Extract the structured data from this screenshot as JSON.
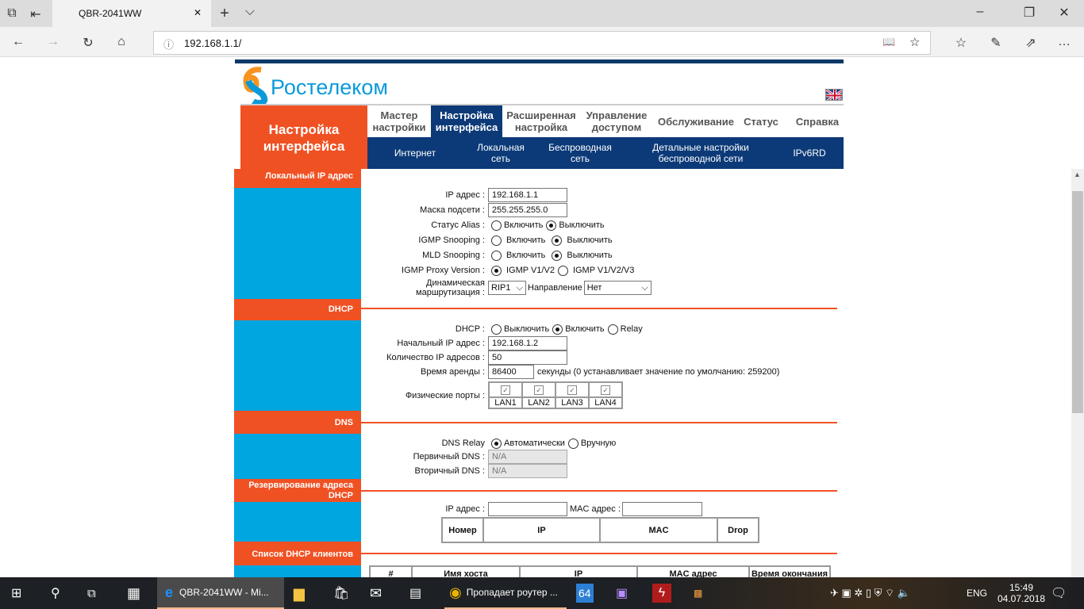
{
  "browser": {
    "tab_title": "QBR-2041WW",
    "url": "192.168.1.1/"
  },
  "brand": {
    "name": "Ростелеком",
    "accent": "#f05123",
    "nav_blue": "#0c3a78",
    "side_blue": "#00a6e0"
  },
  "page_title": "Настройка интерфейса",
  "main_tabs": [
    {
      "l1": "Мастер",
      "l2": "настройки"
    },
    {
      "l1": "Настройка",
      "l2": "интерфейса"
    },
    {
      "l1": "Расширенная",
      "l2": "настройка"
    },
    {
      "l1": "Управление",
      "l2": "доступом"
    },
    {
      "l1": "Обслуживание",
      "l2": ""
    },
    {
      "l1": "Статус",
      "l2": ""
    },
    {
      "l1": "Справка",
      "l2": ""
    }
  ],
  "sub_tabs": [
    {
      "l1": "Интернет",
      "l2": ""
    },
    {
      "l1": "Локальная",
      "l2": "сеть"
    },
    {
      "l1": "Беспроводная",
      "l2": "сеть"
    },
    {
      "l1": "Детальные настройки",
      "l2": "беспроводной сети"
    },
    {
      "l1": "IPv6RD",
      "l2": ""
    }
  ],
  "sections": {
    "lan": "Локальный IP адрес",
    "dhcp": "DHCP",
    "dns": "DNS",
    "reserve": "Резервирование адреса DHCP",
    "clients": "Список DHCP клиентов"
  },
  "lan": {
    "ip_label": "IP адрес :",
    "ip": "192.168.1.1",
    "mask_label": "Маска подсети :",
    "mask": "255.255.255.0",
    "alias_label": "Статус Alias :",
    "igmp_label": "IGMP Snooping :",
    "mld_label": "MLD Snooping :",
    "on": "Включить",
    "off": "Выключить",
    "proxy_label": "IGMP Proxy Version :",
    "proxy_v2": "IGMP V1/V2",
    "proxy_v3": "IGMP V1/V2/V3",
    "dyn_label1": "Динамическая",
    "dyn_label2": "маршрутизация :",
    "rip": "RIP1",
    "dir_label": "Направление",
    "dir": "Нет"
  },
  "dhcp": {
    "label": "DHCP :",
    "off": "Выключить",
    "on": "Включить",
    "relay": "Relay",
    "start_label": "Начальный IP адрес :",
    "start": "192.168.1.2",
    "count_label": "Количество IP адресов :",
    "count": "50",
    "lease_label": "Время аренды :",
    "lease": "86400",
    "lease_note": "секунды (0 устанавливает значение по умолчанию: 259200)",
    "ports_label": "Физические порты :",
    "ports": [
      "LAN1",
      "LAN2",
      "LAN3",
      "LAN4"
    ]
  },
  "dns": {
    "relay_label": "DNS Relay",
    "auto": "Автоматически",
    "manual": "Вручную",
    "primary_label": "Первичный DNS :",
    "primary": "N/A",
    "secondary_label": "Вторичный DNS :",
    "secondary": "N/A"
  },
  "reserve": {
    "ip_label": "IP адрес :",
    "mac_label": "MAC адрес :",
    "columns": [
      "Номер",
      "IP",
      "MAC",
      "Drop"
    ]
  },
  "clients": {
    "columns": [
      "#",
      "Имя хоста",
      "IP",
      "MAC адрес",
      "Время окончания"
    ]
  },
  "taskbar": {
    "edge": "QBR-2041WW - Mi...",
    "chrome": "Пропадает роутер ...",
    "aida": "64",
    "lang": "ENG",
    "time": "15:49",
    "date": "04.07.2018"
  }
}
